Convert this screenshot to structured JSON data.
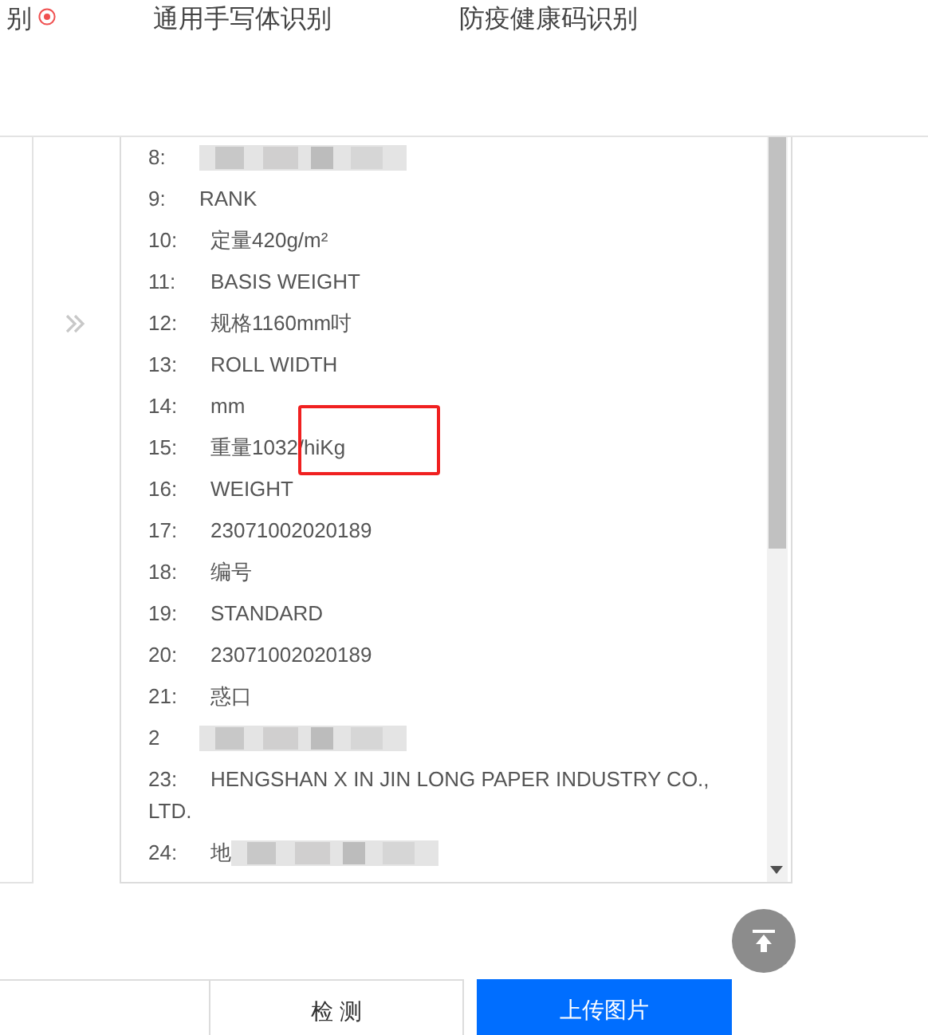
{
  "tabs": [
    {
      "label": "别",
      "badge": true
    },
    {
      "label": "通用手写体识别",
      "badge": false
    },
    {
      "label": "防疫健康码识别",
      "badge": false
    }
  ],
  "result_lines": [
    {
      "num": "8:",
      "redacted": true
    },
    {
      "num": "9:",
      "text": "RANK",
      "redacted": false
    },
    {
      "num": "10:",
      "text": "定量420g/m²",
      "redacted": false
    },
    {
      "num": "11:",
      "text": "BASIS WEIGHT",
      "redacted": false
    },
    {
      "num": "12:",
      "text": "规格1160mm吋",
      "redacted": false
    },
    {
      "num": "13:",
      "text": "ROLL WIDTH",
      "redacted": false
    },
    {
      "num": "14:",
      "text": "mm",
      "redacted": false
    },
    {
      "num": "15:",
      "text": "重量1032/hiKg",
      "redacted": false
    },
    {
      "num": "16:",
      "text": "WEIGHT",
      "redacted": false
    },
    {
      "num": "17:",
      "text": "23071002020189",
      "redacted": false
    },
    {
      "num": "18:",
      "text": "编号",
      "redacted": false
    },
    {
      "num": "19:",
      "text": "STANDARD",
      "redacted": false
    },
    {
      "num": "20:",
      "text": "23071002020189",
      "redacted": false
    },
    {
      "num": "21:",
      "text": "惑口",
      "redacted": false
    },
    {
      "num": "2",
      "redacted": true
    },
    {
      "num": "23:",
      "text": "HENGSHAN X IN JIN LONG PAPER INDUSTRY CO., LTD.",
      "redacted": false
    },
    {
      "num": "24:",
      "text": "地",
      "redacted": true
    }
  ],
  "buttons": [
    {
      "label": "检 测",
      "kind": "secondary"
    },
    {
      "label": "上传图片",
      "kind": "primary"
    }
  ]
}
